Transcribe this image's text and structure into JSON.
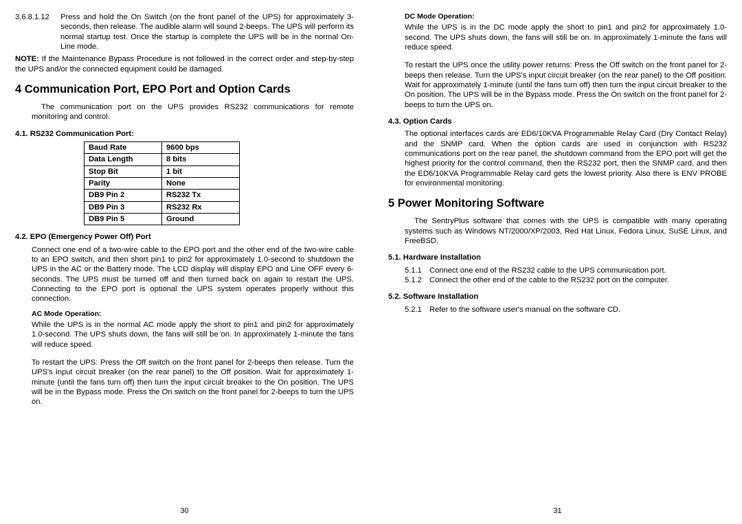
{
  "left": {
    "step_num": "3.6.8.1.12",
    "step_text": "Press and hold the On Switch (on the front panel of the UPS) for approximately 3-seconds, then release. The audible alarm will sound 2-beeps. The UPS will perform its normal startup test. Once the startup is complete the UPS will be in the normal On-Line mode.",
    "note_label": "NOTE:",
    "note_text": " If the Maintenance Bypass Procedure is not followed in the correct order and step-by-step the UPS and/or the connected equipment could be damaged.",
    "sec4_title": "4   Communication Port, EPO Port and Option Cards",
    "sec4_intro": "The communication port on the UPS provides RS232 communications for remote monitoring and control.",
    "sec41_title": "4.1.  RS232 Communication Port:",
    "table": [
      [
        "Baud Rate",
        "9600 bps"
      ],
      [
        "Data Length",
        "8 bits"
      ],
      [
        "Stop Bit",
        "1 bit"
      ],
      [
        "Parity",
        "None"
      ],
      [
        "DB9 Pin 2",
        "RS232 Tx"
      ],
      [
        "DB9 Pin 3",
        "RS232 Rx"
      ],
      [
        "DB9 Pin 5",
        "Ground"
      ]
    ],
    "sec42_title": "4.2.  EPO (Emergency Power Off) Port",
    "sec42_body": "Connect one end of a two-wire cable to the EPO port and the other end of the two-wire cable to an EPO switch, and then short pin1 to pin2 for approximately 1.0-second to shutdown the UPS in the AC or the Battery mode. The LCD display will display EPO and Line OFF every 6-seconds. The UPS must be turned off and then turned back on again to restart the UPS. Connecting to the EPO port is optional the UPS system operates properly without this connection.",
    "ac_head": "AC Mode Operation:",
    "ac_p1": "While the UPS is in the normal AC mode apply the short to pin1 and pin2 for approximately 1.0-second. The UPS shuts down, the fans will still be on. In approximately 1-minute the fans will reduce speed.",
    "ac_p2": "To restart the UPS: Press the Off switch on the front panel for 2-beeps then release. Turn the UPS's input circuit breaker (on the rear panel) to the Off position. Wait for approximately 1-minute (until the fans turn off) then turn the input circuit breaker to the On position. The UPS will be in the Bypass mode. Press the On switch on the front panel for 2-beeps to turn the UPS on.",
    "page_num": "30"
  },
  "right": {
    "dc_head": "DC Mode Operation:",
    "dc_p1": "While the UPS is in the DC mode apply the short to pin1 and pin2 for approximately 1.0-second. The UPS shuts down, the fans will still be on. In approximately 1-minute the fans will reduce speed.",
    "dc_p2": "To restart the UPS once the utility power returns: Press the Off switch on the front panel for 2-beeps then release. Turn the UPS's input circuit breaker (on the rear panel) to the Off position. Wait for approximately 1-minute (until the fans turn off) then turn the input circuit breaker to the On position. The UPS will be in the Bypass mode. Press the On switch on the front panel for 2-beeps to turn the UPS on.",
    "sec43_title": "4.3.  Option Cards",
    "sec43_body": "The optional interfaces cards are ED6/10KVA Programmable Relay Card (Dry Contact Relay) and the SNMP card. When the option cards are used in conjunction with RS232 communications port on the rear panel, the shutdown command from the EPO port will get the highest priority for the control command, then the RS232 port, then the SNMP card, and then the ED6/10KVA Programmable Relay card gets the lowest priority. Also there is ENV PROBE for environmental monitoring.",
    "sec5_title": "5   Power Monitoring Software",
    "sec5_intro": "The SentryPlus software that comes with the UPS is compatible with many operating systems such as Windows NT/2000/XP/2003, Red Hat Linux, Fedora Linux, SuSE Linux, and FreeBSD.",
    "sec51_title": "5.1.  Hardware Installation",
    "i511n": "5.1.1",
    "i511": "Connect one end of the RS232 cable to the UPS communication port.",
    "i512n": "5.1.2",
    "i512": "Connect the other end of the cable to the RS232 port on the computer.",
    "sec52_title": "5.2.  Software Installation",
    "i521n": "5.2.1",
    "i521": "Refer to the software user's manual on the software CD.",
    "page_num": "31"
  }
}
